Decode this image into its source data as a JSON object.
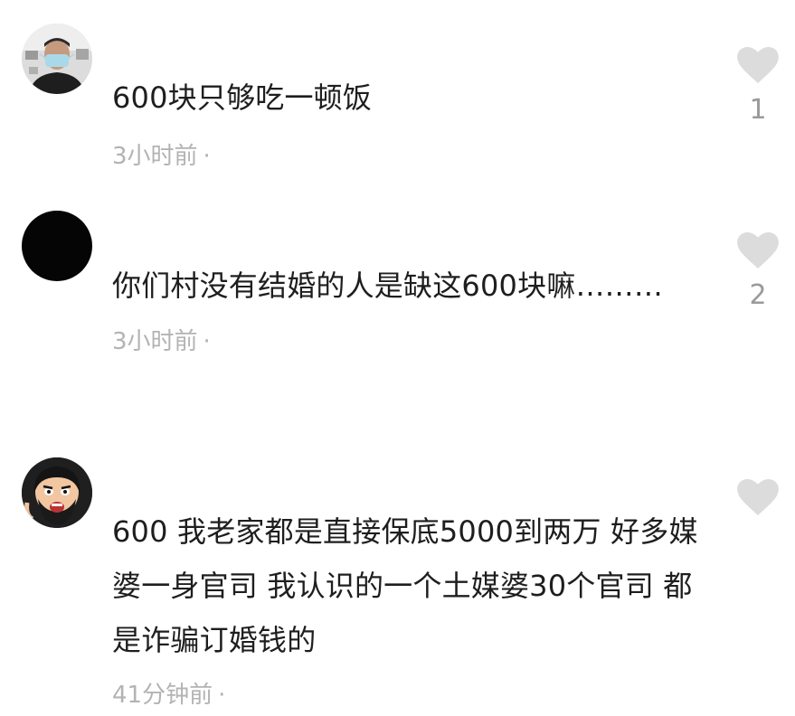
{
  "comments": [
    {
      "text": "600块只够吃一顿饭",
      "time": "3小时前",
      "separator": "·",
      "likes": "1",
      "avatar": "masked-man-avatar"
    },
    {
      "text": "你们村没有结婚的人是缺这600块嘛………",
      "time": "3小时前",
      "separator": "·",
      "likes": "2",
      "avatar": "black-avatar"
    },
    {
      "text": "600 我老家都是直接保底5000到两万 好多媒婆一身官司 我认识的一个土媒婆30个官司 都是诈骗订婚钱的",
      "time": "41分钟前",
      "separator": "·",
      "likes": "",
      "avatar": "cartoon-bearded-avatar"
    }
  ],
  "colors": {
    "heart": "#dcdcdc",
    "meta_text": "#b3b3b3",
    "like_count": "#9a9a9a",
    "body_text": "#1e1e1e"
  }
}
